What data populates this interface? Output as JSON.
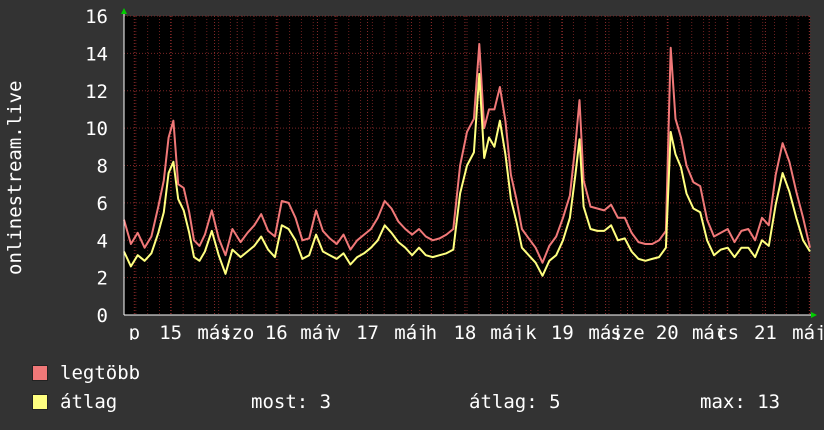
{
  "chart_data": {
    "type": "line",
    "ylabel": "onlinestream.live",
    "ylim": [
      0,
      16
    ],
    "yticks": [
      0,
      2,
      4,
      6,
      8,
      10,
      12,
      14,
      16
    ],
    "xlim": [
      0,
      1
    ],
    "xtick_labels": [
      {
        "x": 0.015,
        "text": "p"
      },
      {
        "x": 0.068,
        "text": "15"
      },
      {
        "x": 0.132,
        "text": "máj"
      },
      {
        "x": 0.165,
        "text": "szo"
      },
      {
        "x": 0.222,
        "text": "16"
      },
      {
        "x": 0.282,
        "text": "máj"
      },
      {
        "x": 0.308,
        "text": "v"
      },
      {
        "x": 0.355,
        "text": "17"
      },
      {
        "x": 0.419,
        "text": "máj"
      },
      {
        "x": 0.448,
        "text": "h"
      },
      {
        "x": 0.497,
        "text": "18"
      },
      {
        "x": 0.559,
        "text": "máj"
      },
      {
        "x": 0.593,
        "text": "k"
      },
      {
        "x": 0.639,
        "text": "19"
      },
      {
        "x": 0.702,
        "text": "máj"
      },
      {
        "x": 0.734,
        "text": "sze"
      },
      {
        "x": 0.792,
        "text": "20"
      },
      {
        "x": 0.853,
        "text": "máj"
      },
      {
        "x": 0.88,
        "text": "cs"
      },
      {
        "x": 0.935,
        "text": "21"
      },
      {
        "x": 0.999,
        "text": "máj"
      }
    ],
    "grid": true,
    "series": [
      {
        "name": "legtöbb",
        "color": "#f07878",
        "points": [
          [
            0.0,
            5.1
          ],
          [
            0.01,
            3.8
          ],
          [
            0.02,
            4.4
          ],
          [
            0.03,
            3.6
          ],
          [
            0.04,
            4.2
          ],
          [
            0.05,
            5.8
          ],
          [
            0.058,
            7.2
          ],
          [
            0.065,
            9.5
          ],
          [
            0.072,
            10.4
          ],
          [
            0.079,
            7.0
          ],
          [
            0.087,
            6.8
          ],
          [
            0.095,
            5.5
          ],
          [
            0.102,
            4.0
          ],
          [
            0.11,
            3.7
          ],
          [
            0.118,
            4.3
          ],
          [
            0.128,
            5.6
          ],
          [
            0.138,
            4.1
          ],
          [
            0.148,
            3.2
          ],
          [
            0.158,
            4.6
          ],
          [
            0.17,
            3.9
          ],
          [
            0.18,
            4.4
          ],
          [
            0.19,
            4.8
          ],
          [
            0.2,
            5.4
          ],
          [
            0.21,
            4.5
          ],
          [
            0.22,
            4.2
          ],
          [
            0.23,
            6.1
          ],
          [
            0.24,
            6.0
          ],
          [
            0.25,
            5.2
          ],
          [
            0.26,
            4.0
          ],
          [
            0.27,
            4.1
          ],
          [
            0.28,
            5.6
          ],
          [
            0.29,
            4.5
          ],
          [
            0.3,
            4.1
          ],
          [
            0.31,
            3.8
          ],
          [
            0.32,
            4.3
          ],
          [
            0.33,
            3.5
          ],
          [
            0.34,
            4.0
          ],
          [
            0.35,
            4.3
          ],
          [
            0.36,
            4.6
          ],
          [
            0.37,
            5.2
          ],
          [
            0.38,
            6.1
          ],
          [
            0.39,
            5.7
          ],
          [
            0.4,
            5.0
          ],
          [
            0.41,
            4.6
          ],
          [
            0.42,
            4.3
          ],
          [
            0.43,
            4.6
          ],
          [
            0.44,
            4.2
          ],
          [
            0.45,
            4.0
          ],
          [
            0.46,
            4.1
          ],
          [
            0.47,
            4.3
          ],
          [
            0.48,
            4.6
          ],
          [
            0.49,
            8.0
          ],
          [
            0.5,
            9.8
          ],
          [
            0.51,
            10.5
          ],
          [
            0.518,
            14.5
          ],
          [
            0.525,
            10.0
          ],
          [
            0.532,
            11.0
          ],
          [
            0.54,
            11.0
          ],
          [
            0.548,
            12.2
          ],
          [
            0.556,
            10.4
          ],
          [
            0.564,
            7.5
          ],
          [
            0.572,
            6.2
          ],
          [
            0.58,
            4.6
          ],
          [
            0.59,
            4.1
          ],
          [
            0.6,
            3.6
          ],
          [
            0.61,
            2.8
          ],
          [
            0.62,
            3.7
          ],
          [
            0.63,
            4.2
          ],
          [
            0.64,
            5.2
          ],
          [
            0.65,
            6.4
          ],
          [
            0.658,
            9.1
          ],
          [
            0.664,
            11.5
          ],
          [
            0.67,
            7.2
          ],
          [
            0.68,
            5.8
          ],
          [
            0.69,
            5.7
          ],
          [
            0.7,
            5.6
          ],
          [
            0.71,
            5.9
          ],
          [
            0.72,
            5.2
          ],
          [
            0.73,
            5.2
          ],
          [
            0.74,
            4.4
          ],
          [
            0.75,
            3.9
          ],
          [
            0.76,
            3.8
          ],
          [
            0.77,
            3.8
          ],
          [
            0.78,
            4.0
          ],
          [
            0.79,
            4.5
          ],
          [
            0.797,
            14.3
          ],
          [
            0.804,
            10.5
          ],
          [
            0.812,
            9.5
          ],
          [
            0.82,
            8.0
          ],
          [
            0.83,
            7.1
          ],
          [
            0.84,
            6.9
          ],
          [
            0.85,
            5.1
          ],
          [
            0.86,
            4.2
          ],
          [
            0.87,
            4.4
          ],
          [
            0.88,
            4.6
          ],
          [
            0.89,
            3.9
          ],
          [
            0.9,
            4.5
          ],
          [
            0.91,
            4.6
          ],
          [
            0.92,
            4.0
          ],
          [
            0.93,
            5.2
          ],
          [
            0.94,
            4.8
          ],
          [
            0.95,
            7.5
          ],
          [
            0.96,
            9.2
          ],
          [
            0.97,
            8.2
          ],
          [
            0.98,
            6.6
          ],
          [
            0.99,
            5.2
          ],
          [
            1.0,
            3.6
          ]
        ]
      },
      {
        "name": "átlag",
        "color": "#ffff80",
        "points": [
          [
            0.0,
            3.4
          ],
          [
            0.01,
            2.6
          ],
          [
            0.02,
            3.2
          ],
          [
            0.03,
            2.9
          ],
          [
            0.04,
            3.3
          ],
          [
            0.05,
            4.4
          ],
          [
            0.058,
            5.5
          ],
          [
            0.065,
            7.6
          ],
          [
            0.072,
            8.2
          ],
          [
            0.079,
            6.2
          ],
          [
            0.087,
            5.6
          ],
          [
            0.095,
            4.4
          ],
          [
            0.102,
            3.1
          ],
          [
            0.11,
            2.9
          ],
          [
            0.118,
            3.4
          ],
          [
            0.128,
            4.5
          ],
          [
            0.138,
            3.2
          ],
          [
            0.148,
            2.2
          ],
          [
            0.158,
            3.5
          ],
          [
            0.17,
            3.1
          ],
          [
            0.18,
            3.4
          ],
          [
            0.19,
            3.7
          ],
          [
            0.2,
            4.2
          ],
          [
            0.21,
            3.5
          ],
          [
            0.22,
            3.1
          ],
          [
            0.23,
            4.8
          ],
          [
            0.24,
            4.6
          ],
          [
            0.25,
            4.0
          ],
          [
            0.26,
            3.0
          ],
          [
            0.27,
            3.2
          ],
          [
            0.28,
            4.3
          ],
          [
            0.29,
            3.4
          ],
          [
            0.3,
            3.2
          ],
          [
            0.31,
            3.0
          ],
          [
            0.32,
            3.3
          ],
          [
            0.33,
            2.7
          ],
          [
            0.34,
            3.1
          ],
          [
            0.35,
            3.3
          ],
          [
            0.36,
            3.6
          ],
          [
            0.37,
            4.0
          ],
          [
            0.38,
            4.8
          ],
          [
            0.39,
            4.4
          ],
          [
            0.4,
            3.9
          ],
          [
            0.41,
            3.6
          ],
          [
            0.42,
            3.2
          ],
          [
            0.43,
            3.6
          ],
          [
            0.44,
            3.2
          ],
          [
            0.45,
            3.1
          ],
          [
            0.46,
            3.2
          ],
          [
            0.47,
            3.3
          ],
          [
            0.48,
            3.5
          ],
          [
            0.49,
            6.5
          ],
          [
            0.5,
            8.0
          ],
          [
            0.51,
            8.7
          ],
          [
            0.518,
            12.9
          ],
          [
            0.525,
            8.4
          ],
          [
            0.532,
            9.5
          ],
          [
            0.54,
            9.0
          ],
          [
            0.548,
            10.4
          ],
          [
            0.556,
            8.6
          ],
          [
            0.564,
            6.2
          ],
          [
            0.572,
            5.0
          ],
          [
            0.58,
            3.6
          ],
          [
            0.59,
            3.2
          ],
          [
            0.6,
            2.8
          ],
          [
            0.61,
            2.1
          ],
          [
            0.62,
            2.9
          ],
          [
            0.63,
            3.2
          ],
          [
            0.64,
            4.0
          ],
          [
            0.65,
            5.2
          ],
          [
            0.658,
            7.5
          ],
          [
            0.664,
            9.4
          ],
          [
            0.67,
            5.8
          ],
          [
            0.68,
            4.6
          ],
          [
            0.69,
            4.5
          ],
          [
            0.7,
            4.5
          ],
          [
            0.71,
            4.8
          ],
          [
            0.72,
            4.0
          ],
          [
            0.73,
            4.1
          ],
          [
            0.74,
            3.4
          ],
          [
            0.75,
            3.0
          ],
          [
            0.76,
            2.9
          ],
          [
            0.77,
            3.0
          ],
          [
            0.78,
            3.1
          ],
          [
            0.79,
            3.6
          ],
          [
            0.797,
            9.8
          ],
          [
            0.804,
            8.6
          ],
          [
            0.812,
            7.9
          ],
          [
            0.82,
            6.5
          ],
          [
            0.83,
            5.7
          ],
          [
            0.84,
            5.5
          ],
          [
            0.85,
            4.0
          ],
          [
            0.86,
            3.2
          ],
          [
            0.87,
            3.5
          ],
          [
            0.88,
            3.6
          ],
          [
            0.89,
            3.1
          ],
          [
            0.9,
            3.6
          ],
          [
            0.91,
            3.6
          ],
          [
            0.92,
            3.1
          ],
          [
            0.93,
            4.0
          ],
          [
            0.94,
            3.7
          ],
          [
            0.95,
            5.9
          ],
          [
            0.96,
            7.6
          ],
          [
            0.97,
            6.6
          ],
          [
            0.98,
            5.2
          ],
          [
            0.99,
            4.0
          ],
          [
            1.0,
            3.4
          ]
        ]
      }
    ]
  },
  "legend": {
    "max_label": "legtöbb",
    "avg_label": "átlag",
    "max_color": "#f07878",
    "avg_color": "#ffff80"
  },
  "stats": {
    "now": "most: 3",
    "avg": "átlag: 5",
    "max": "max: 13"
  }
}
